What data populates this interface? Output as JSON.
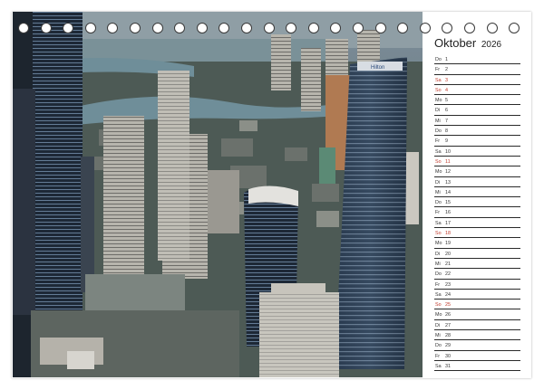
{
  "calendar": {
    "month": "Oktober",
    "year": "2026",
    "days": [
      {
        "name": "Do",
        "day": "1",
        "weekend": false
      },
      {
        "name": "Fr",
        "day": "2",
        "weekend": false
      },
      {
        "name": "Sa",
        "day": "3",
        "weekend": true
      },
      {
        "name": "So",
        "day": "4",
        "weekend": true
      },
      {
        "name": "Mo",
        "day": "5",
        "weekend": false
      },
      {
        "name": "Di",
        "day": "6",
        "weekend": false
      },
      {
        "name": "Mi",
        "day": "7",
        "weekend": false
      },
      {
        "name": "Do",
        "day": "8",
        "weekend": false
      },
      {
        "name": "Fr",
        "day": "9",
        "weekend": false
      },
      {
        "name": "Sa",
        "day": "10",
        "weekend": false
      },
      {
        "name": "So",
        "day": "11",
        "weekend": true
      },
      {
        "name": "Mo",
        "day": "12",
        "weekend": false
      },
      {
        "name": "Di",
        "day": "13",
        "weekend": false
      },
      {
        "name": "Mi",
        "day": "14",
        "weekend": false
      },
      {
        "name": "Do",
        "day": "15",
        "weekend": false
      },
      {
        "name": "Fr",
        "day": "16",
        "weekend": false
      },
      {
        "name": "Sa",
        "day": "17",
        "weekend": false
      },
      {
        "name": "So",
        "day": "18",
        "weekend": true
      },
      {
        "name": "Mo",
        "day": "19",
        "weekend": false
      },
      {
        "name": "Di",
        "day": "20",
        "weekend": false
      },
      {
        "name": "Mi",
        "day": "21",
        "weekend": false
      },
      {
        "name": "Do",
        "day": "22",
        "weekend": false
      },
      {
        "name": "Fr",
        "day": "23",
        "weekend": false
      },
      {
        "name": "Sa",
        "day": "24",
        "weekend": false
      },
      {
        "name": "So",
        "day": "25",
        "weekend": true
      },
      {
        "name": "Mo",
        "day": "26",
        "weekend": false
      },
      {
        "name": "Di",
        "day": "27",
        "weekend": false
      },
      {
        "name": "Mi",
        "day": "28",
        "weekend": false
      },
      {
        "name": "Do",
        "day": "29",
        "weekend": false
      },
      {
        "name": "Fr",
        "day": "30",
        "weekend": false
      },
      {
        "name": "Sa",
        "day": "31",
        "weekend": false
      }
    ]
  },
  "colors": {
    "weekend": "#c0392b",
    "rule": "#2a2a2a",
    "ring": "#3a3a3a"
  },
  "photo": {
    "subject": "city skyline with high-rise towers and a river",
    "tower_sign": "Hilton"
  }
}
